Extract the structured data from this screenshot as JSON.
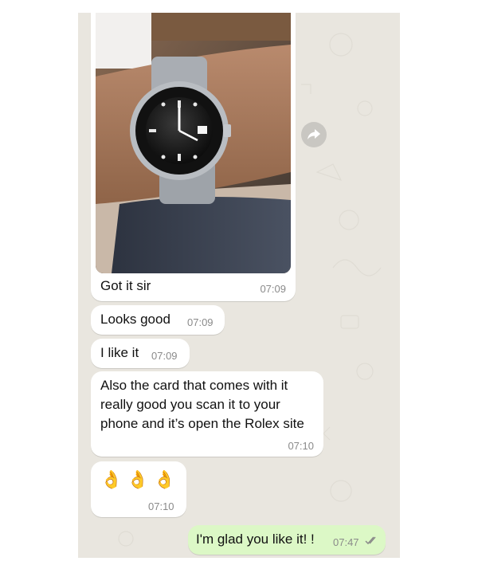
{
  "messages": [
    {
      "type": "image",
      "caption": "Got it sir",
      "time": "07:09"
    },
    {
      "type": "text",
      "text": "Looks good",
      "time": "07:09"
    },
    {
      "type": "text",
      "text": "I like it",
      "time": "07:09"
    },
    {
      "type": "text",
      "text": "Also the card that comes with it really good you scan it to your phone and it’s open the Rolex site",
      "time": "07:10"
    },
    {
      "type": "emoji",
      "text": "👌👌👌",
      "time": "07:10"
    },
    {
      "type": "outgoing",
      "text": "I'm glad you like it! !",
      "time": "07:47",
      "status": "read-double-check"
    }
  ],
  "icons": {
    "forward": "forward-arrow-icon",
    "read_receipt": "double-check-icon"
  },
  "colors": {
    "chat_bg": "#e9e6df",
    "incoming": "#ffffff",
    "outgoing": "#dcf8c6",
    "meta": "#8a8a8a",
    "ticks": "#8a8a8a"
  }
}
